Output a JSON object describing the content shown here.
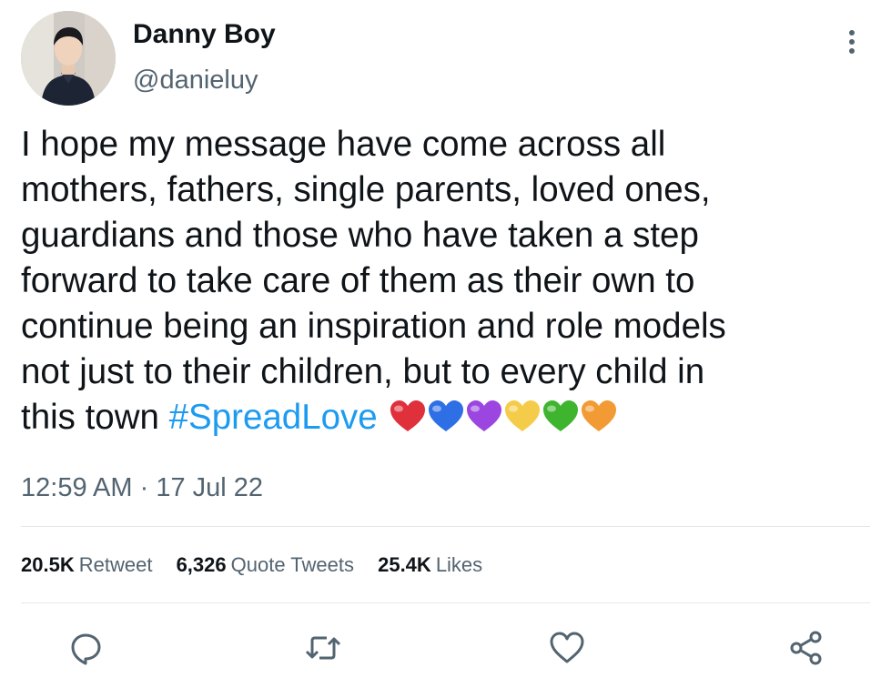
{
  "author": {
    "display_name": "Danny Boy",
    "handle": "@danieluy"
  },
  "tweet": {
    "lines": [
      "I hope my message have come across all",
      "mothers, fathers, single parents, loved ones,",
      "guardians and those who have taken a step",
      "forward to take care of them as their own to",
      "continue being an inspiration and role models",
      "not just to their children, but to every child in"
    ],
    "last_line_prefix": "this town ",
    "hashtag": "#SpreadLove",
    "hearts": [
      "#e0303b",
      "#2f6fe5",
      "#9b46e0",
      "#f5cc4a",
      "#3fb52f",
      "#f29a33"
    ]
  },
  "meta": {
    "time": "12:59 AM",
    "separator": " · ",
    "date": "17 Jul 22"
  },
  "stats": {
    "retweets": {
      "value": "20.5K",
      "label": "Retweet"
    },
    "quotes": {
      "value": "6,326",
      "label": "Quote Tweets"
    },
    "likes": {
      "value": "25.4K",
      "label": "Likes"
    }
  },
  "colors": {
    "text": "#0f1419",
    "secondary": "#536471",
    "link": "#1d9bf0",
    "divider": "#e3e7ea"
  },
  "icons": {
    "more": "more-vertical-icon",
    "reply": "reply-icon",
    "retweet": "retweet-icon",
    "like": "heart-icon",
    "share": "share-icon"
  }
}
